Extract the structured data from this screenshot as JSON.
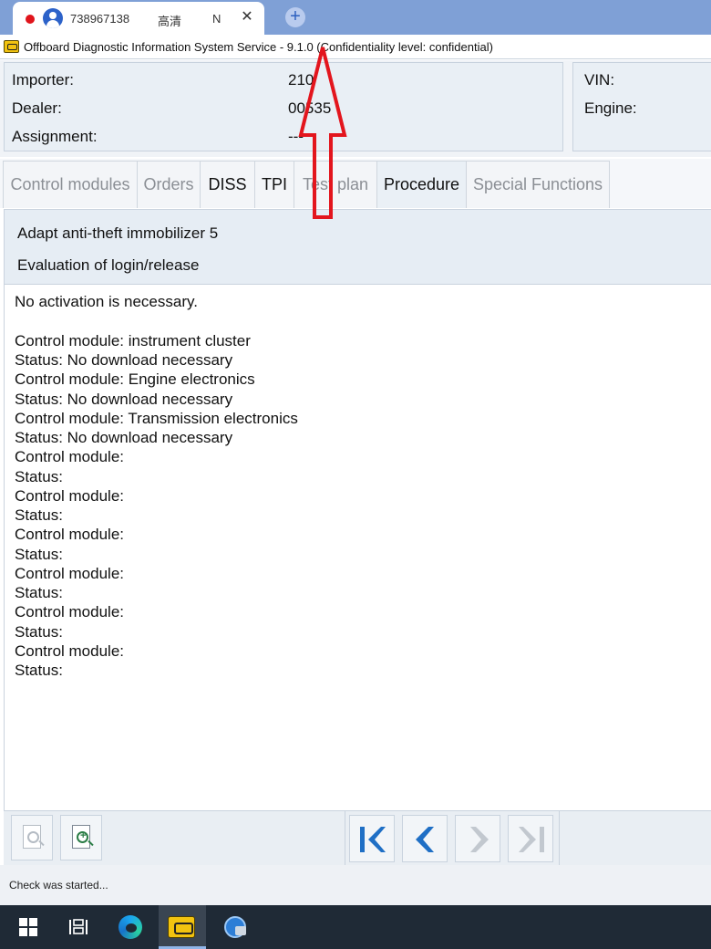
{
  "browser": {
    "tab_id": "738967138",
    "tab_quality": "高清",
    "tab_letter": "N",
    "close_glyph": "✕",
    "new_tab_glyph": "+"
  },
  "app": {
    "title": "Offboard Diagnostic Information System Service - 9.1.0 (Confidentiality level: confidential)"
  },
  "info": {
    "importer_label": "Importer:",
    "importer_value": "210",
    "dealer_label": "Dealer:",
    "dealer_value": "00535",
    "assignment_label": "Assignment:",
    "assignment_value": "---",
    "vin_label": "VIN:",
    "engine_label": "Engine:"
  },
  "tabs": [
    {
      "label": "Control modules",
      "state": "disabled"
    },
    {
      "label": "Orders",
      "state": "disabled"
    },
    {
      "label": "DISS",
      "state": "enabled"
    },
    {
      "label": "TPI",
      "state": "enabled"
    },
    {
      "label": "Test plan",
      "state": "disabled"
    },
    {
      "label": "Procedure",
      "state": "active"
    },
    {
      "label": "Special Functions",
      "state": "disabled"
    }
  ],
  "procedure": {
    "title": "Adapt anti-theft immobilizer 5",
    "subtitle": "Evaluation of login/release"
  },
  "content": {
    "intro": "No activation is necessary.",
    "lines": [
      "Control module: instrument cluster",
      "Status: No download necessary",
      "Control module: Engine electronics",
      "Status: No download necessary",
      "Control module: Transmission electronics",
      "Status: No download necessary",
      "Control module:",
      "Status:",
      "Control module:",
      "Status:",
      "Control module:",
      "Status:",
      "Control module:",
      "Status:",
      "Control module:",
      "Status:",
      "Control module:",
      "Status:"
    ]
  },
  "toolbar": {
    "buttons": [
      {
        "icon": "zoom-out-document-icon",
        "enabled": false
      },
      {
        "icon": "zoom-in-document-icon",
        "enabled": true
      }
    ],
    "nav": [
      {
        "icon": "first-page-icon",
        "enabled": true
      },
      {
        "icon": "previous-page-icon",
        "enabled": true
      },
      {
        "icon": "next-page-icon",
        "enabled": false
      },
      {
        "icon": "last-page-icon",
        "enabled": false
      }
    ]
  },
  "status": {
    "text": "Check was started..."
  },
  "taskbar": {
    "items": [
      "windows-start-icon",
      "task-view-icon",
      "edge-browser-icon",
      "odis-app-icon",
      "network-globe-icon"
    ]
  },
  "colors": {
    "tab_strip": "#7fa0d6",
    "panel_bg": "#e9eff5",
    "nav_blue": "#1f6fc5",
    "nav_disabled": "#c2c8cf",
    "annotation_red": "#e3151d",
    "taskbar": "#1f2a36"
  }
}
